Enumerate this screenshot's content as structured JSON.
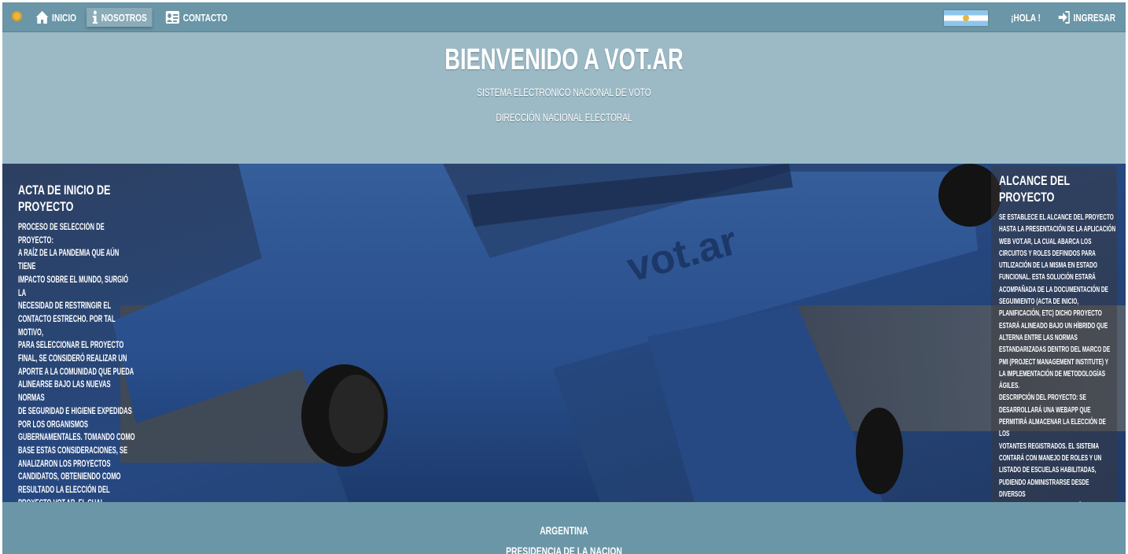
{
  "nav": {
    "items": [
      {
        "label": "INICIO",
        "icon": "home-icon"
      },
      {
        "label": "NOSOTROS",
        "icon": "info-icon",
        "active": true
      },
      {
        "label": "CONTACTO",
        "icon": "contact-card-icon"
      }
    ],
    "greeting": "¡HOLA !",
    "login_label": "INGRESAR"
  },
  "hero": {
    "title": "BIENVENIDO A VOT.AR",
    "subtitle1": "SISTEMA ELECTRONICO NACIONAL DE VOTO",
    "subtitle2": "DIRECCIÓN NACIONAL ELECTORAL"
  },
  "banner": {
    "logo_text": "vot.ar"
  },
  "left_panel": {
    "title": "ACTA DE INICIO DE\nPROYECTO",
    "body": "PROCESO DE SELECCIÓN DE PROYECTO:\nA RAÍZ DE LA PANDEMIA QUE AÚN TIENE\nIMPACTO SOBRE EL MUNDO, SURGIÓ LA\nNECESIDAD DE RESTRINGIR EL\nCONTACTO ESTRECHO. POR TAL MOTIVO,\nPARA SELECCIONAR EL PROYECTO\nFINAL, SE CONSIDERÓ REALIZAR UN\nAPORTE A LA COMUNIDAD QUE PUEDA\nALINEARSE BAJO LAS NUEVAS NORMAS\nDE SEGURIDAD E HIGIENE EXPEDIDAS\nPOR LOS ORGANISMOS\nGUBERNAMENTALES. TOMANDO COMO\nBASE ESTAS CONSIDERACIONES, SE\nANALIZARON LOS PROYECTOS\nCANDIDATOS, OBTENIENDO COMO\nRESULTADO LA ELECCIÓN DEL\nPROYECTO VOT.AR. EL CUAL,\nCONCUERDA CON EL OBJETIVO\nPLANTEADO INICIALMENTE EN SU\nTOTALIDAD."
  },
  "right_panel": {
    "title": "ALCANCE DEL PROYECTO",
    "body": "SE ESTABLECE EL ALCANCE DEL PROYECTO\nHASTA LA PRESENTACIÓN DE LA APLICACIÓN\nWEB VOT.AR, LA CUAL ABARCA LOS\nCIRCUITOS Y ROLES DEFINIDOS PARA\nUTILIZACIÓN DE LA MISMA EN ESTADO\nFUNCIONAL. ESTA SOLUCIÓN ESTARÁ\nACOMPAÑADA DE LA DOCUMENTACIÓN DE\nSEGUIMIENTO (ACTA DE INICIO,\nPLANIFICACIÓN, ETC) DICHO PROYECTO\nESTARÁ ALINEADO BAJO UN HÍBRIDO QUE\nALTERNA ENTRE LAS NORMAS\nESTANDARIZADAS DENTRO DEL MARCO DE\nPMI (PROJECT MANAGEMENT INSTITUTE) Y\nLA IMPLEMENTACIÓN DE METODOLOGÍAS\nÁGILES.\nDESCRIPCIÓN DEL PROYECTO: SE\nDESARROLLARÁ UNA WEBAPP QUE\nPERMITIRÁ ALMACENAR LA ELECCIÓN DE LOS\nVOTANTES REGISTRADOS. EL SISTEMA\nCONTARÁ CON MANEJO DE ROLES Y UN\nLISTADO DE ESCUELAS HABILITADAS,\nPUDIENDO ADMINISTRARSE DESDE DIVERSOS\nPERFILES. LOS MISMOS ESTARÁN\nINTEGRADOS EN UN CIRCUITO DE\nAPROBACIÓN, LO CUAL PERMITIRÁ LA\nFINALIZACIÓN DE LAS SOLICITUDES."
  },
  "footer": {
    "line1": "ARGENTINA",
    "line2": "PRESIDENCIA DE LA NACION"
  },
  "colors": {
    "nav_bg": "#6a96a7",
    "hero_bg": "#9bbac6",
    "banner_blue": "#2d4f8a"
  }
}
